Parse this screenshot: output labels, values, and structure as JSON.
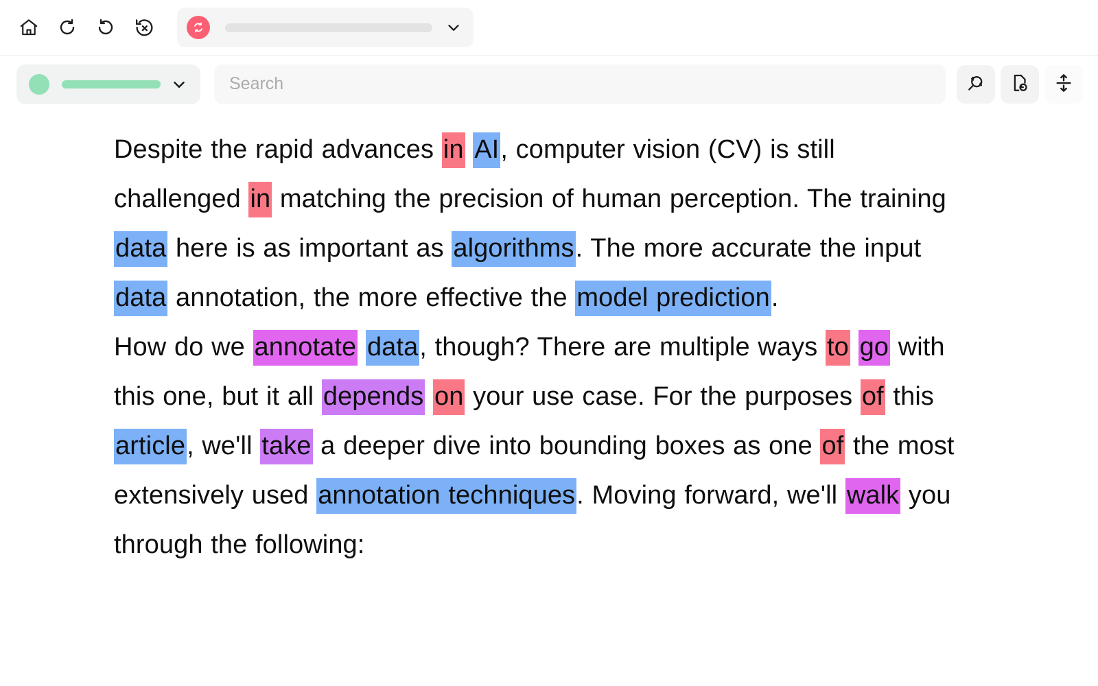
{
  "toolbar_top": {
    "buttons": [
      {
        "name": "home-button",
        "icon": "home-icon",
        "label": "Home"
      },
      {
        "name": "undo-button",
        "icon": "undo-icon",
        "label": "Undo"
      },
      {
        "name": "redo-button",
        "icon": "redo-icon",
        "label": "Redo"
      },
      {
        "name": "reset-button",
        "icon": "reset-history-icon",
        "label": "Reset"
      }
    ],
    "document_selector": {
      "badge_icon": "sync-circle-icon",
      "badge_color": "#fa5f73",
      "skeleton_color": "#e3e3e4",
      "chevron_icon": "chevron-down-icon"
    }
  },
  "toolbar_second": {
    "label_selector": {
      "dot_color": "#93e0b7",
      "skeleton_color": "#93e0b7",
      "chevron_icon": "chevron-down-icon"
    },
    "search": {
      "placeholder": "Search",
      "value": ""
    },
    "tools": [
      {
        "name": "search-refresh-button",
        "icon": "search-refresh-icon",
        "label": "Re-run search"
      },
      {
        "name": "document-refresh-button",
        "icon": "document-refresh-icon",
        "label": "Refresh document"
      },
      {
        "name": "expand-vertical-button",
        "icon": "expand-vertical-icon",
        "label": "Expand rows"
      }
    ]
  },
  "document": {
    "paragraphs": [
      {
        "id": "paragraph-1",
        "runs": [
          {
            "t": "Despite the rapid advances ",
            "h": "none"
          },
          {
            "t": "in",
            "h": "red"
          },
          {
            "t": " ",
            "h": "none"
          },
          {
            "t": "AI",
            "h": "blue"
          },
          {
            "t": ", computer vision (CV) is still challenged ",
            "h": "none"
          },
          {
            "t": "in",
            "h": "red"
          },
          {
            "t": " matching the precision of human perception. The training ",
            "h": "none"
          },
          {
            "t": "data",
            "h": "blue"
          },
          {
            "t": " here is as important as ",
            "h": "none"
          },
          {
            "t": "algorithms",
            "h": "blue"
          },
          {
            "t": ". The more accurate the input ",
            "h": "none"
          },
          {
            "t": "data",
            "h": "blue"
          },
          {
            "t": " annotation, the more effective the ",
            "h": "none"
          },
          {
            "t": "model prediction",
            "h": "blue"
          },
          {
            "t": ".",
            "h": "none"
          }
        ]
      },
      {
        "id": "paragraph-2",
        "runs": [
          {
            "t": "How do we ",
            "h": "none"
          },
          {
            "t": "annotate",
            "h": "magenta"
          },
          {
            "t": " ",
            "h": "none"
          },
          {
            "t": "data",
            "h": "blue"
          },
          {
            "t": ", though? There are multiple ways ",
            "h": "none"
          },
          {
            "t": "to",
            "h": "red"
          },
          {
            "t": " ",
            "h": "none"
          },
          {
            "t": "go",
            "h": "magenta"
          },
          {
            "t": " with this one, but it all ",
            "h": "none"
          },
          {
            "t": "depends",
            "h": "violet"
          },
          {
            "t": " ",
            "h": "none"
          },
          {
            "t": "on",
            "h": "red"
          },
          {
            "t": " your use case. For the purposes ",
            "h": "none"
          },
          {
            "t": "of",
            "h": "red"
          },
          {
            "t": " this ",
            "h": "none"
          },
          {
            "t": "article",
            "h": "blue"
          },
          {
            "t": ", we'll ",
            "h": "none"
          },
          {
            "t": "take",
            "h": "violet"
          },
          {
            "t": " a deeper dive into bounding boxes as one ",
            "h": "none"
          },
          {
            "t": "of",
            "h": "red"
          },
          {
            "t": " the most extensively used ",
            "h": "none"
          },
          {
            "t": "annotation techniques",
            "h": "blue"
          },
          {
            "t": ". Moving forward, we'll ",
            "h": "none"
          },
          {
            "t": "walk",
            "h": "magenta"
          },
          {
            "t": " you through the following:",
            "h": "none"
          }
        ]
      }
    ]
  },
  "highlight_colors": {
    "red": "#fa7886",
    "blue": "#7cb1f7",
    "magenta": "#e066f0",
    "violet": "#cb7cf5"
  }
}
